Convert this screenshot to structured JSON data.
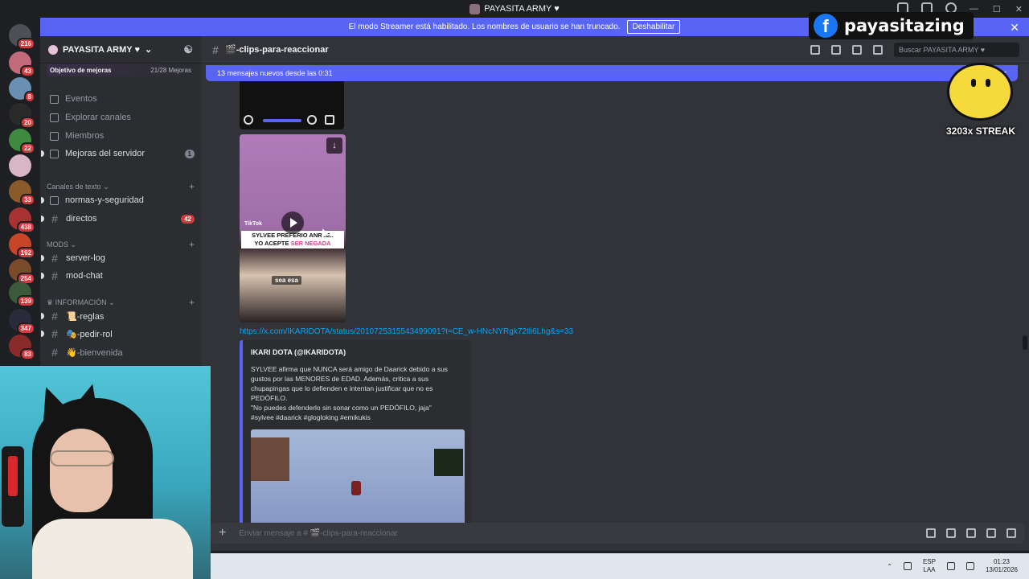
{
  "window": {
    "title": "PAYASITA ARMY ♥"
  },
  "streamer_banner": {
    "text": "El modo Streamer está habilitado. Los nombres de usuario se han truncado.",
    "button": "Deshabilitar"
  },
  "guilds": [
    {
      "badge": "216",
      "color": "#4e5058"
    },
    {
      "badge": "43",
      "color": "#c06a7a"
    },
    {
      "badge": "8",
      "color": "#6a8fb0"
    },
    {
      "badge": "20",
      "color": "#2a2a2a"
    },
    {
      "badge": "22",
      "color": "#3f8a3f"
    },
    {
      "badge": "",
      "color": "#d8b7c4"
    },
    {
      "badge": "33",
      "color": "#8a5a2a"
    },
    {
      "badge": "438",
      "color": "#a83232"
    },
    {
      "badge": "192",
      "color": "#c8452a"
    },
    {
      "badge": "254",
      "color": "#7a4a2a"
    },
    {
      "badge": "139",
      "color": "#3a5a3a"
    },
    {
      "badge": "347",
      "color": "#2a2a3a"
    },
    {
      "badge": "83",
      "color": "#8a2a2a"
    }
  ],
  "server": {
    "name": "PAYASITA ARMY ♥",
    "boost_goal": "Objetivo de mejoras",
    "boost_count": "21/28 Mejoras",
    "items": [
      {
        "label": "Eventos"
      },
      {
        "label": "Explorar canales"
      },
      {
        "label": "Miembros"
      },
      {
        "label": "Mejoras del servidor",
        "count": "1"
      }
    ],
    "categories": [
      {
        "label": "Canales de texto"
      },
      {
        "label": "MODS"
      },
      {
        "label": "INFORMACIÓN"
      }
    ],
    "channels": [
      {
        "label": "normas-y-seguridad"
      },
      {
        "label": "directos",
        "count": "42"
      },
      {
        "label": "server-log"
      },
      {
        "label": "mod-chat"
      },
      {
        "label": "📜-reglas"
      },
      {
        "label": "🎭-pedir-rol"
      },
      {
        "label": "👋-bienvenida"
      }
    ]
  },
  "chat": {
    "channel": "🎬-clips-para-reaccionar",
    "search_placeholder": "Buscar PAYASITA ARMY ♥",
    "new_messages": "13 mensajes nuevos desde las 0:31",
    "mark_read": "Mar",
    "thumb": {
      "tiktok": "TikTok",
      "caption_a": "SYLVEE PREFERIO AN",
      "caption_b": "RSE..",
      "caption_c": "YO ACEPTE ",
      "caption_d": "SER NEGADA",
      "caption2": "sea esa"
    },
    "link": "https://x.com/IKARIDOTA/status/2010725315543499091?t=CE_w-HNcNYRgk72tli6Lhg&s=33",
    "embed": {
      "author": "IKARI DOTA (@IKARIDOTA)",
      "line1": "SYLVEE afirma que NUNCA será amigo de Daarick debido a sus",
      "line2": "gustos por las MENORES de EDAD. Además, critica a sus",
      "line3": "chupapingas que lo defienden e intentan justificar que no es",
      "line4": "PEDÓFILO.",
      "line5": "\"No puedes defenderlo sin sonar como un PEDÓFILO, jaja\"",
      "line6": "#sylvee #daarick #glogloking #emikukis"
    },
    "composer_placeholder": "Enviar mensaje a # 🎬-clips-para-reaccionar"
  },
  "overlay": {
    "facebook_name": "payasitazing",
    "streak": "3203x STREAK"
  },
  "taskbar": {
    "lang_top": "ESP",
    "lang_bottom": "LAA",
    "time": "01:23",
    "date": "13/01/2026"
  }
}
